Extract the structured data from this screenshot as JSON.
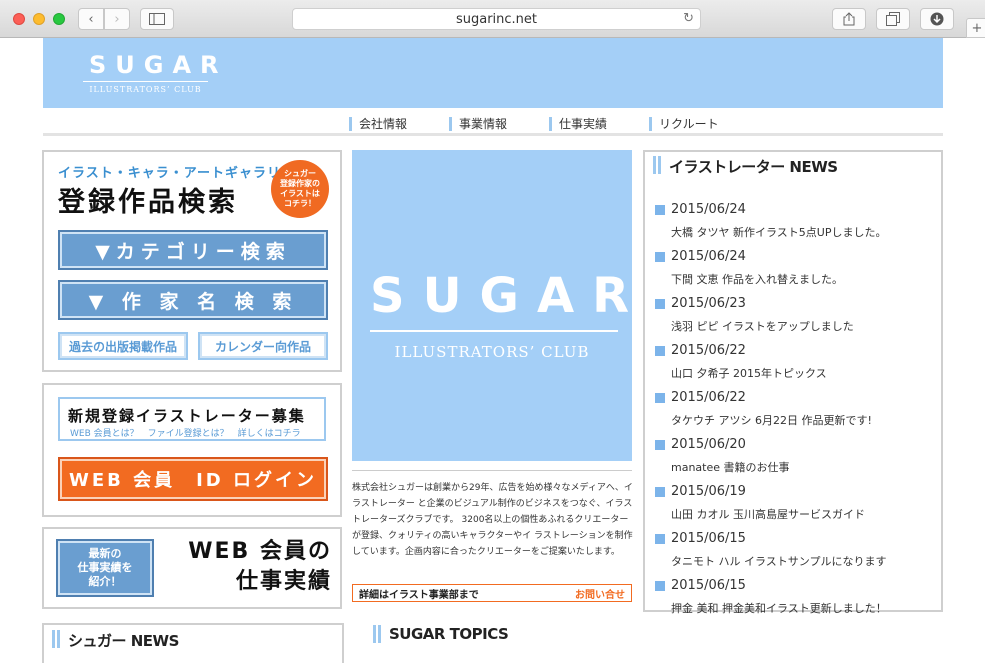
{
  "browser": {
    "url": "sugarinc.net",
    "back_glyph": "‹",
    "forward_glyph": "›",
    "reload_glyph": "↻",
    "plus_glyph": "+"
  },
  "site": {
    "logo_word": "SUGAR",
    "logo_sub": "ILLUSTRATORS’ CLUB",
    "brand_color": "#a4cff7",
    "accent_color": "#f26b21"
  },
  "nav": {
    "items": [
      {
        "label": "会社情報"
      },
      {
        "label": "事業情報"
      },
      {
        "label": "仕事実績"
      },
      {
        "label": "リクルート"
      }
    ]
  },
  "gallery": {
    "tag": "イラスト・キャラ・アートギャラリー",
    "title": "登録作品検索",
    "badge": "シュガー\n登録作家の\nイラストは\nコチラ！",
    "category_button": "▼カテゴリー検索",
    "artist_button": "▼ 作 家 名 検 索",
    "past_button": "過去の出版掲載作品",
    "calendar_button": "カレンダー向作品"
  },
  "member": {
    "recruit_title": "新規登録イラストレーター募集",
    "links": "WEB 会員とは？　ファイル登録とは？　詳しくはコチラ",
    "login_button": "WEB 会員　ID ログイン"
  },
  "works": {
    "recent_button": "最新の\n仕事実績を\n紹介！",
    "title": "WEB 会員の\n仕事実績"
  },
  "hero": {
    "word": "SUGAR",
    "sub": "ILLUSTRATORS’ CLUB"
  },
  "about": {
    "text": "株式会社シュガーは創業から29年、広告を始め様々なメディアへ、イラストレーター と企業のビジュアル制作のビジネスをつなぐ、イラストレーターズクラブです。 3200名以上の個性あふれるクリエーターが登録、クォリティの高いキャラクターやイ ラストレーションを制作しています。企画内容に合ったクリエーターをご提案いたします。",
    "detail_label": "詳細はイラスト事業部まで",
    "contact_link": "お問い合せ"
  },
  "news": {
    "heading": "イラストレーター NEWS",
    "items": [
      {
        "date": "2015/06/24",
        "text": "大橋 タツヤ 新作イラスト5点UPしました。"
      },
      {
        "date": "2015/06/24",
        "text": "下間 文恵 作品を入れ替えました。"
      },
      {
        "date": "2015/06/23",
        "text": "浅羽 ピピ イラストをアップしました"
      },
      {
        "date": "2015/06/22",
        "text": "山口 夕希子 2015年トピックス"
      },
      {
        "date": "2015/06/22",
        "text": "タケウチ アツシ 6月22日 作品更新です!"
      },
      {
        "date": "2015/06/20",
        "text": "manatee 書籍のお仕事"
      },
      {
        "date": "2015/06/19",
        "text": "山田 カオル 玉川高島屋サービスガイド"
      },
      {
        "date": "2015/06/15",
        "text": "タニモト ハル イラストサンプルになります"
      },
      {
        "date": "2015/06/15",
        "text": "押金 美和 押金美和イラスト更新しました！"
      }
    ]
  },
  "sugar_news": {
    "heading": "シュガー NEWS"
  },
  "topics": {
    "heading": "SUGAR TOPICS"
  }
}
